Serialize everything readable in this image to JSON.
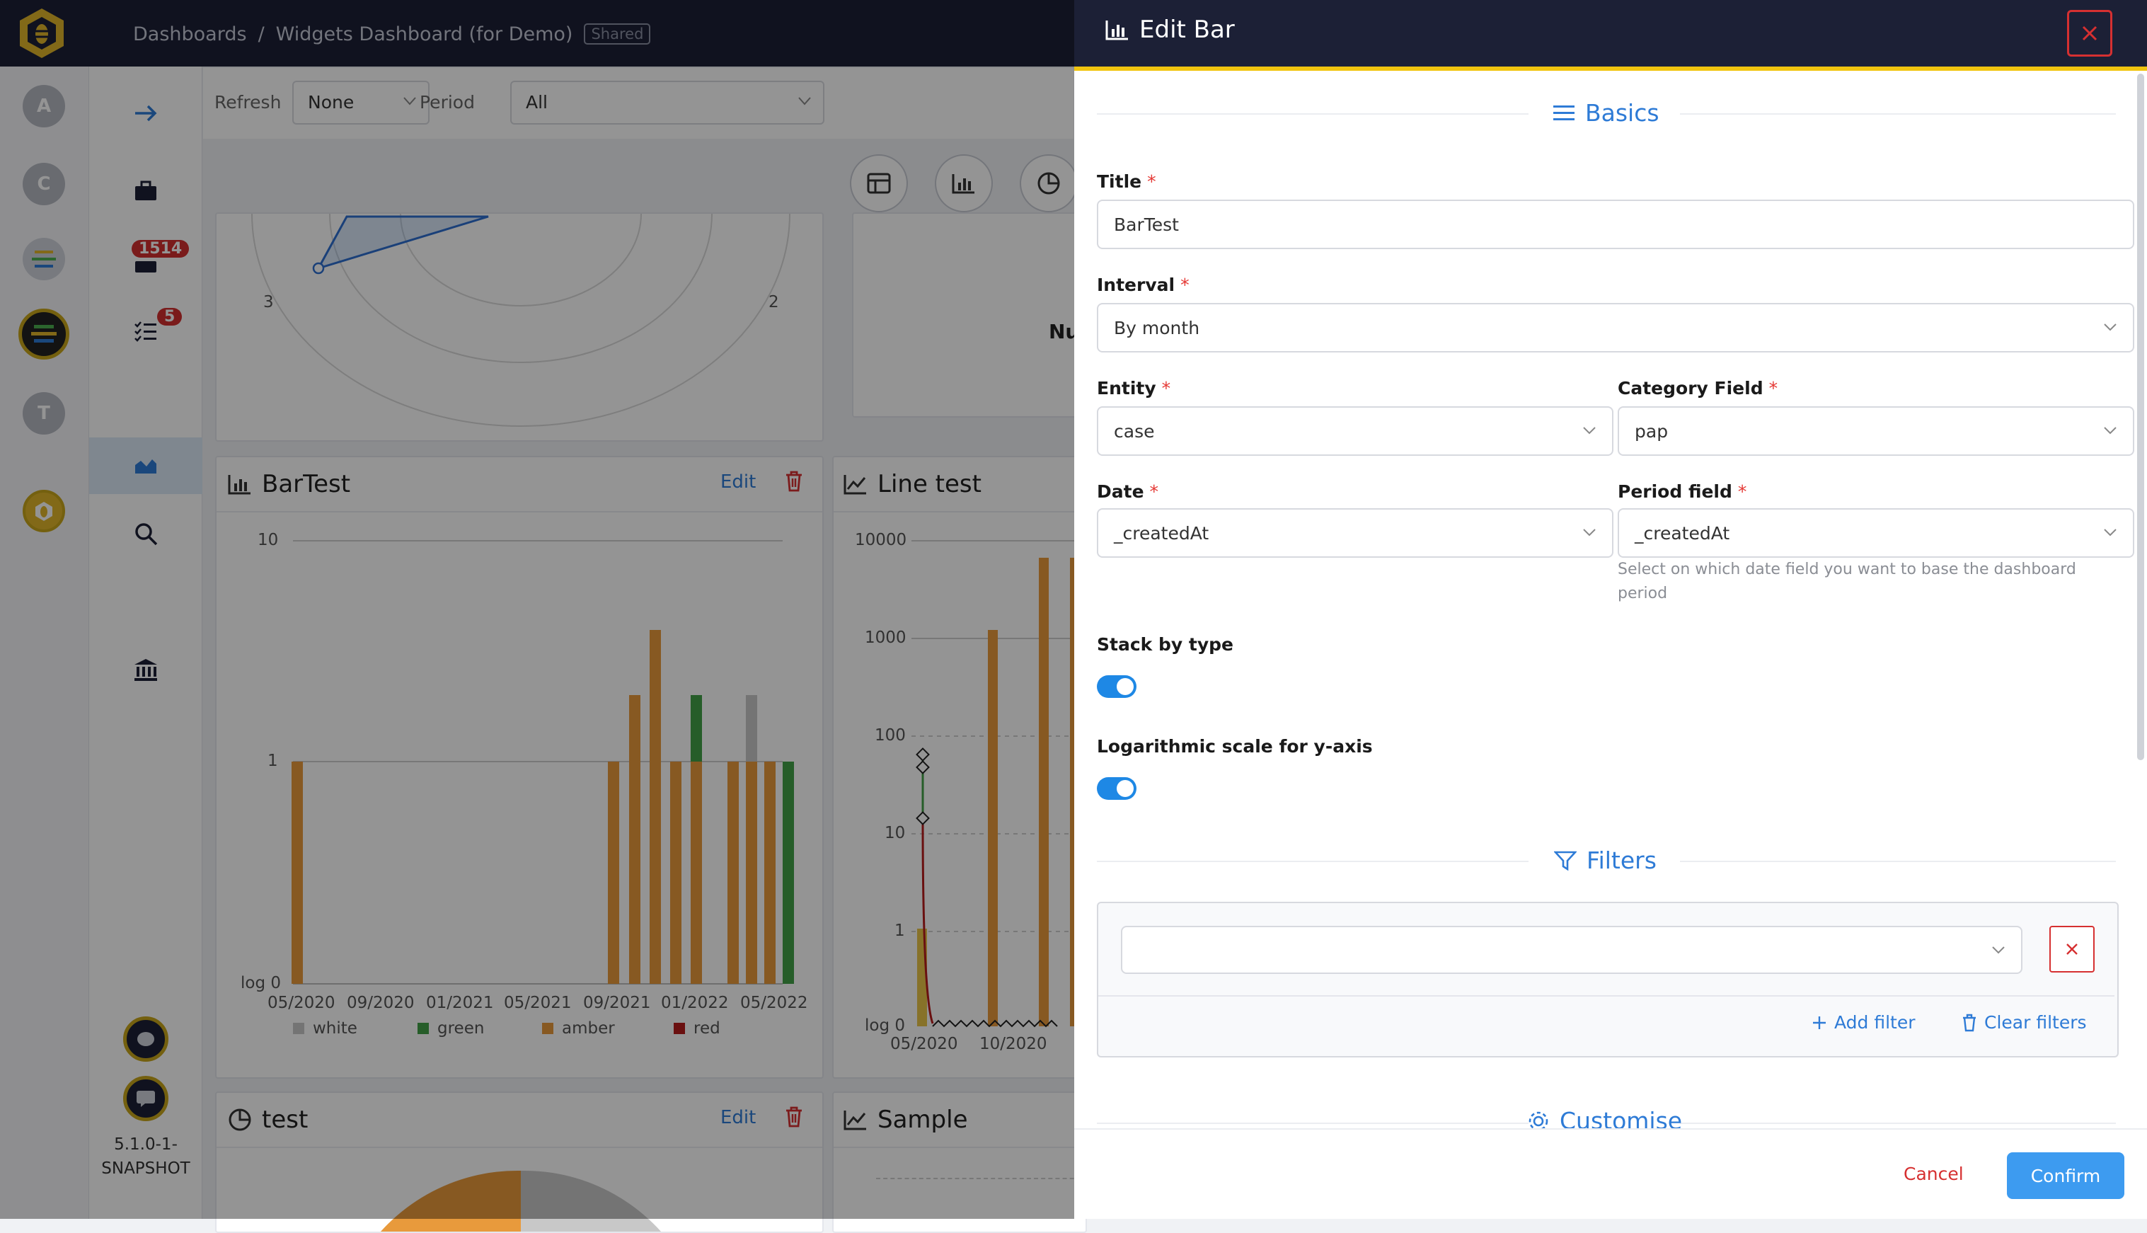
{
  "header": {
    "breadcrumb_root": "Dashboards",
    "breadcrumb_sep": "/",
    "breadcrumb_current": "Widgets Dashboard (for Demo)",
    "shared_badge": "Shared"
  },
  "sidebar": {
    "orgs": [
      "A",
      "C",
      "T"
    ],
    "alerts_count": "1514",
    "tasks_count": "5",
    "version_line1": "5.1.0-1-",
    "version_line2": "SNAPSHOT"
  },
  "toolbar": {
    "refresh_label": "Refresh",
    "refresh_value": "None",
    "period_label": "Period",
    "period_value": "All"
  },
  "widgets": {
    "bar": {
      "title": "BarTest",
      "edit": "Edit",
      "y_ticks": [
        "10",
        "1",
        "log 0"
      ],
      "x_ticks": [
        "05/2020",
        "09/2020",
        "01/2021",
        "05/2021",
        "09/2021",
        "01/2022",
        "05/2022"
      ],
      "legend": [
        "white",
        "green",
        "amber",
        "red"
      ]
    },
    "line": {
      "title": "Line test",
      "y_ticks": [
        "10000",
        "1000",
        "100",
        "10",
        "1",
        "log 0"
      ],
      "x_ticks": [
        "05/2020",
        "10/2020"
      ]
    },
    "radar_ticks": [
      "3",
      "2"
    ],
    "pie": {
      "title": "test",
      "edit": "Edit"
    },
    "sample": {
      "title": "Sample"
    },
    "partial_text": "Nu"
  },
  "drawer": {
    "title": "Edit Bar",
    "basics_title": "Basics",
    "title_label": "Title",
    "title_value": "BarTest",
    "interval_label": "Interval",
    "interval_value": "By month",
    "entity_label": "Entity",
    "entity_value": "case",
    "category_label": "Category Field",
    "category_value": "pap",
    "date_label": "Date",
    "date_value": "_createdAt",
    "period_field_label": "Period field",
    "period_field_value": "_createdAt",
    "period_field_hint_1": "Select on which date field you want to base the dashboard",
    "period_field_hint_2": "period",
    "stack_label": "Stack by type",
    "log_label": "Logarithmic scale for y-axis",
    "filters_title": "Filters",
    "add_filter": "Add filter",
    "clear_filters": "Clear filters",
    "customise_title": "Customise",
    "cancel": "Cancel",
    "confirm": "Confirm"
  },
  "colors": {
    "accent": "#2e7bd6",
    "header_bg": "#1c2036",
    "amber": "#e89a3c",
    "green": "#43a047",
    "white_series": "#c8c8c8",
    "red": "#b71c1c",
    "danger": "#d63031",
    "confirm_bg": "#3d9bf0"
  }
}
